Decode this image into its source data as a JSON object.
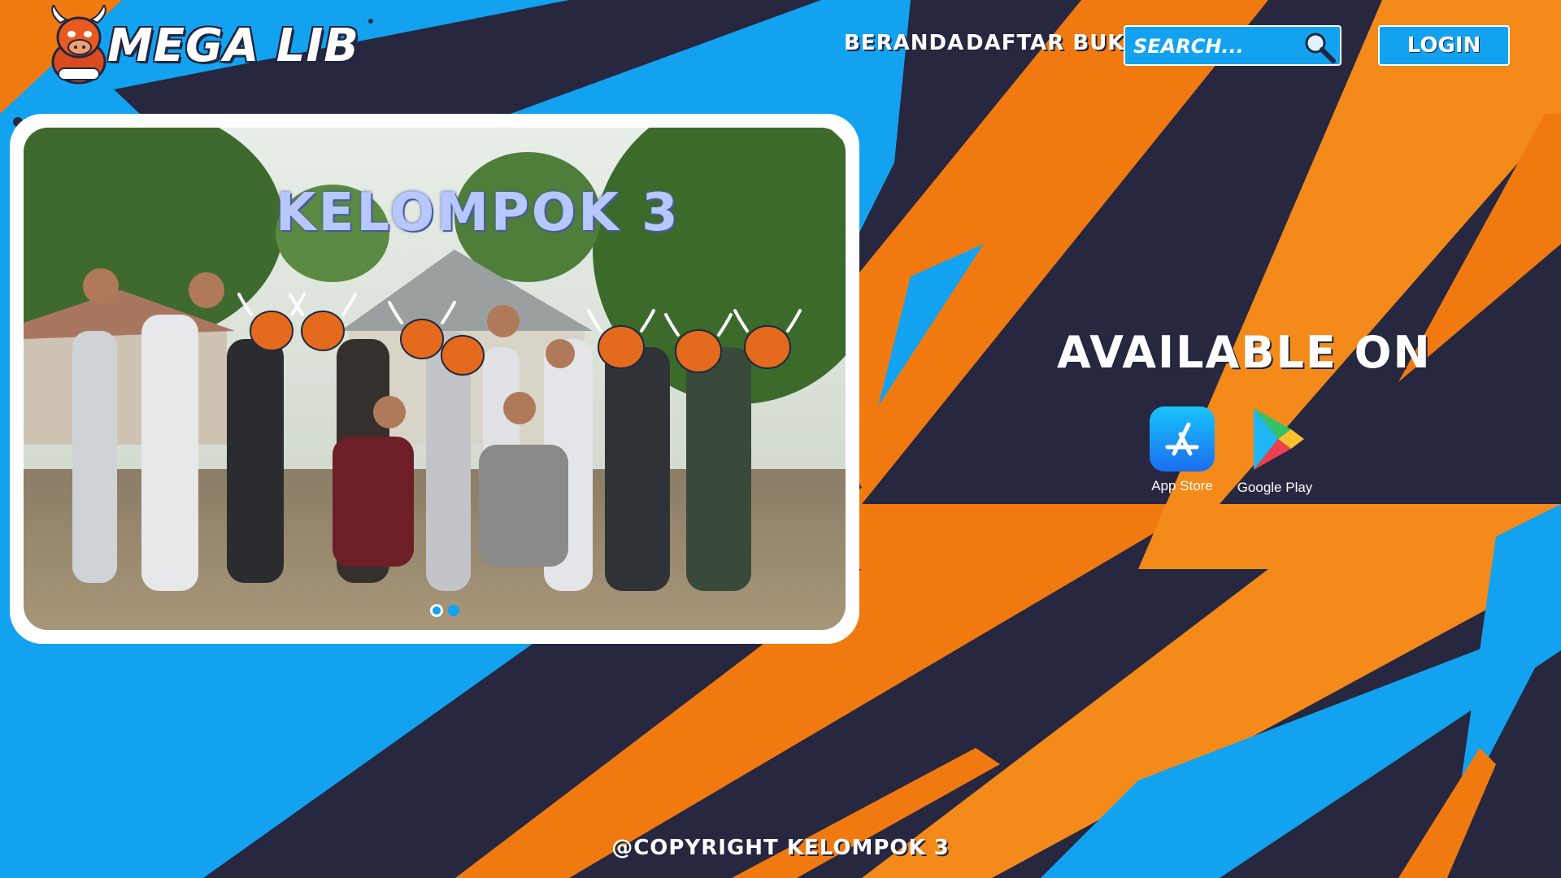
{
  "brand": {
    "name": "MEGA LIB",
    "mascot_icon": "bull-mascot-icon"
  },
  "nav": {
    "items": [
      {
        "label": "BERANDA"
      },
      {
        "label": "DAFTAR BUKU"
      }
    ]
  },
  "search": {
    "placeholder": "SEARCH...",
    "value": "",
    "icon": "search-icon"
  },
  "login": {
    "label": "LOGIN"
  },
  "carousel": {
    "caption": "KELOMPOK 3",
    "slide_count": 2,
    "active_index": 0
  },
  "availability": {
    "heading": "AVAILABLE ON",
    "stores": [
      {
        "label": "App Store",
        "icon": "app-store-icon"
      },
      {
        "label": "Google Play",
        "icon": "google-play-icon"
      }
    ]
  },
  "footer": {
    "text": "@COPYRIGHT KELOMPOK 3"
  },
  "colors": {
    "background_blue": "#12a2f0",
    "dark_navy": "#272740",
    "orange": "#f07a10",
    "white": "#ffffff"
  }
}
